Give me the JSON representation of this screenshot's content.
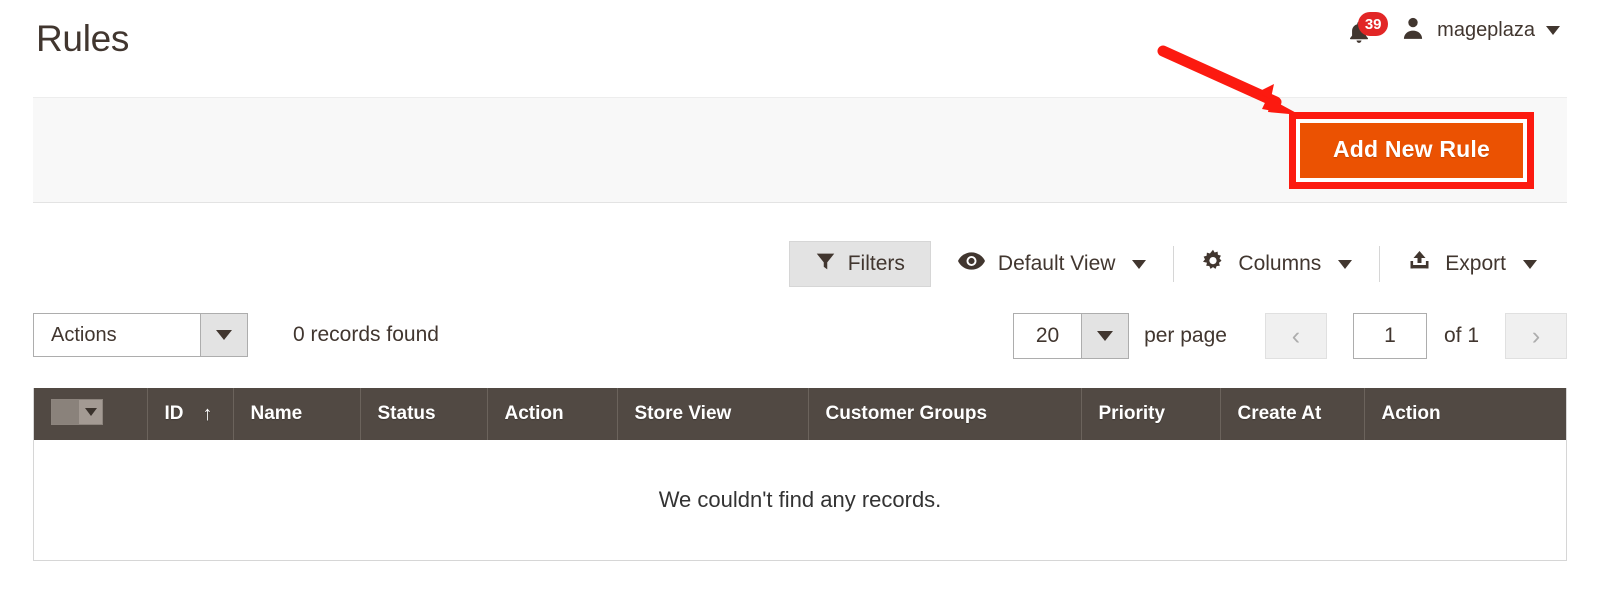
{
  "header": {
    "title": "Rules",
    "notifications": {
      "icon": "bell-icon",
      "count": "39"
    },
    "user": {
      "icon": "user-avatar-icon",
      "name": "mageplaza",
      "caret": "chevron-down-icon"
    }
  },
  "action_band": {
    "add_new_rule_label": "Add New Rule",
    "annotation": {
      "highlight_color": "#fc1a10",
      "arrow_color": "#fc1a10"
    },
    "button_color": "#eb5202"
  },
  "grid_toolbar": {
    "filters": {
      "label": "Filters",
      "icon": "funnel-icon"
    },
    "view": {
      "label": "Default View",
      "icon": "eye-icon",
      "caret": "chevron-down-icon"
    },
    "columns": {
      "label": "Columns",
      "icon": "gear-icon",
      "caret": "chevron-down-icon"
    },
    "export": {
      "label": "Export",
      "icon": "export-upload-icon",
      "caret": "chevron-down-icon"
    }
  },
  "grid_controls": {
    "actions": {
      "label": "Actions",
      "caret": "chevron-down-icon"
    },
    "records_found": "0 records found",
    "pagination": {
      "per_page_value": "20",
      "per_page_label": "per page",
      "prev_label": "‹",
      "next_label": "›",
      "current_page": "1",
      "of_label": "of 1"
    }
  },
  "grid": {
    "columns": [
      {
        "label": "",
        "name": "select-all"
      },
      {
        "label": "ID",
        "name": "id",
        "sort": "↑"
      },
      {
        "label": "Name",
        "name": "name"
      },
      {
        "label": "Status",
        "name": "status"
      },
      {
        "label": "Action",
        "name": "action"
      },
      {
        "label": "Store View",
        "name": "store-view"
      },
      {
        "label": "Customer Groups",
        "name": "customer-groups"
      },
      {
        "label": "Priority",
        "name": "priority"
      },
      {
        "label": "Create At",
        "name": "create-at"
      },
      {
        "label": "Action",
        "name": "action-column"
      }
    ],
    "rows": [],
    "empty_message": "We couldn't find any records."
  }
}
